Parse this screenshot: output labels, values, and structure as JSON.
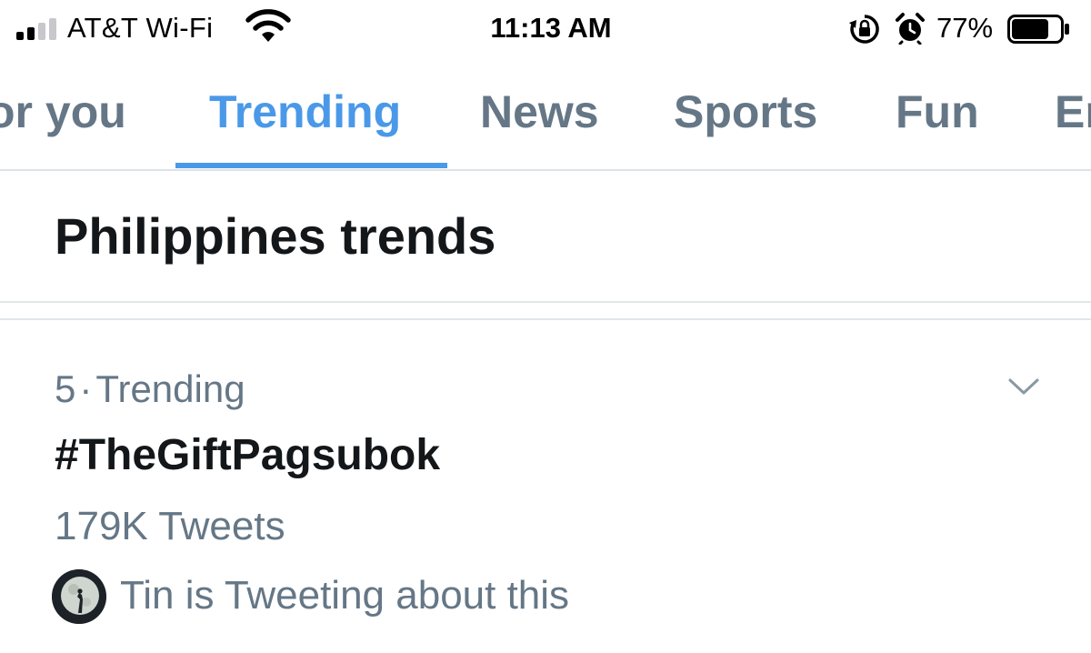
{
  "status_bar": {
    "carrier": "AT&T Wi-Fi",
    "time": "11:13 AM",
    "battery_percent": "77%",
    "battery_level": 0.77,
    "signal_bars": 2,
    "signal_bars_total": 4
  },
  "tabs": [
    {
      "label": "or you"
    },
    {
      "label": "Trending",
      "active": true
    },
    {
      "label": "News"
    },
    {
      "label": "Sports"
    },
    {
      "label": "Fun"
    },
    {
      "label": "En"
    }
  ],
  "section": {
    "title": "Philippines trends"
  },
  "trend": {
    "rank": "5",
    "separator": "·",
    "category": "Trending",
    "name": "#TheGiftPagsubok",
    "count": "179K Tweets",
    "social_context": "Tin is Tweeting about this"
  },
  "colors": {
    "accent": "#4a99e9",
    "secondary_text": "#657786",
    "primary_text": "#14171a",
    "divider": "#e1e6ea"
  },
  "icons": {
    "signal": "cellular-signal-icon",
    "wifi": "wifi-icon",
    "orientation_lock": "orientation-lock-icon",
    "alarm": "alarm-clock-icon",
    "battery": "battery-icon",
    "more": "chevron-down-icon"
  }
}
